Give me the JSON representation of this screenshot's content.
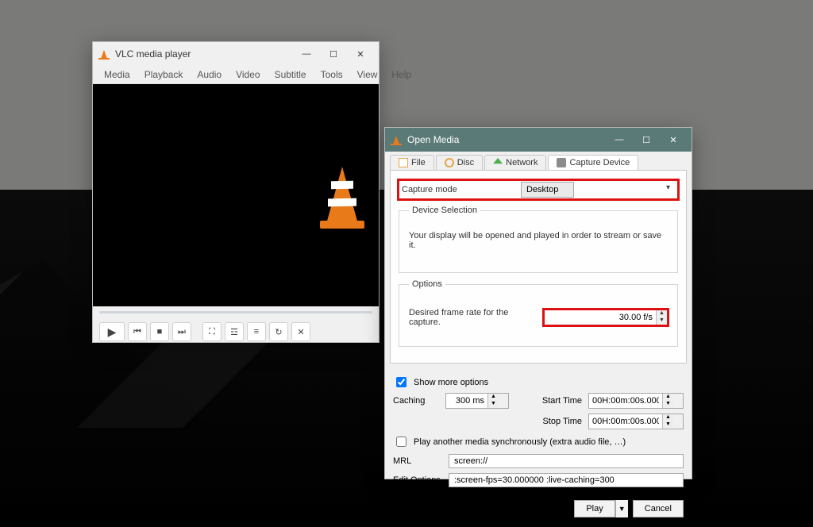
{
  "main_window": {
    "title": "VLC media player",
    "menus": [
      "Media",
      "Playback",
      "Audio",
      "Video",
      "Subtitle",
      "Tools",
      "View",
      "Help"
    ]
  },
  "open_media": {
    "title": "Open Media",
    "tabs": {
      "file": "File",
      "disc": "Disc",
      "network": "Network",
      "capture": "Capture Device"
    },
    "capture_mode_label": "Capture mode",
    "capture_mode_value": "Desktop",
    "device_selection_legend": "Device Selection",
    "device_selection_hint": "Your display will be opened and played in order to stream or save it.",
    "options_legend": "Options",
    "framerate_label": "Desired frame rate for the capture.",
    "framerate_value": "30.00 f/s",
    "show_more_options": "Show more options",
    "caching_label": "Caching",
    "caching_value": "300 ms",
    "start_time_label": "Start Time",
    "start_time_value": "00H:00m:00s.000",
    "stop_time_label": "Stop Time",
    "stop_time_value": "00H:00m:00s.000",
    "play_sync_label": "Play another media synchronously (extra audio file, …)",
    "mrl_label": "MRL",
    "mrl_value": "screen://",
    "edit_options_label": "Edit Options",
    "edit_options_value": ":screen-fps=30.000000 :live-caching=300",
    "play_button": "Play",
    "cancel_button": "Cancel"
  }
}
